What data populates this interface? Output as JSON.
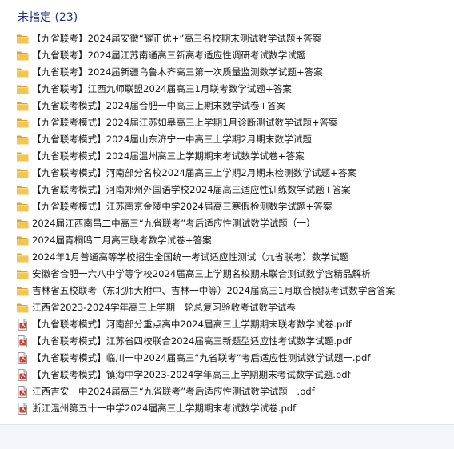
{
  "group": {
    "title": "未指定 (23)"
  },
  "files": [
    {
      "name": "【九省联考】2024届安徽“耀正优+”高三名校期末测试数学试题+答案",
      "icon": "folder-icon"
    },
    {
      "name": "【九省联考】2024届江苏南通高三新高考适应性调研考试数学试题",
      "icon": "folder-icon"
    },
    {
      "name": "【九省联考】2024届新疆乌鲁木齐高三第一次质量监测数学试题+答案",
      "icon": "folder-icon"
    },
    {
      "name": "【九省联考】江西九师联盟2024届高三1月联考数学试题+答案",
      "icon": "folder-icon"
    },
    {
      "name": "【九省联考模式】2024届合肥一中高三上期末数学试卷+答案",
      "icon": "folder-icon"
    },
    {
      "name": "【九省联考模式】2024届江苏如皋高三上学期1月诊断测试数学试题+答案",
      "icon": "folder-icon"
    },
    {
      "name": "【九省联考模式】2024届山东济宁一中高三上学期2月期末数学试题",
      "icon": "folder-icon"
    },
    {
      "name": "【九省联考模式】2024届温州高三上学期期末考试数学试卷+答案",
      "icon": "folder-icon"
    },
    {
      "name": "【九省联考模式】河南部分名校2024届高三上学期2月期末检测数学试题+答案",
      "icon": "folder-icon"
    },
    {
      "name": "【九省联考模式】河南郑州外国语学校2024届高三适应性训练数学试题+答案",
      "icon": "folder-icon"
    },
    {
      "name": "【九省联考模式】江苏南京金陵中学2024届高三寒假检测数学试题+答案",
      "icon": "folder-icon"
    },
    {
      "name": "2024届江西南昌二中高三“九省联考”考后适应性测试数学试题（一）",
      "icon": "folder-icon"
    },
    {
      "name": "2024届青桐鸣二月高三联考数学试卷+答案",
      "icon": "folder-icon"
    },
    {
      "name": "2024年1月普通高等学校招生全国统一考试适应性测试（九省联考）数学试题",
      "icon": "folder-icon"
    },
    {
      "name": "安徽省合肥一六八中学等学校2024届高三上学期名校期末联合测试数学含精品解析",
      "icon": "folder-icon"
    },
    {
      "name": "吉林省五校联考（东北师大附中、吉林一中等）2024届高三1月联合模拟考试数学含答案",
      "icon": "folder-icon"
    },
    {
      "name": "江西省2023-2024学年高三上学期一轮总复习验收考试数学试卷",
      "icon": "folder-icon"
    },
    {
      "name": "【九省联考模式】河南部分重点高中2024届高三上学期期末联考数学试卷.pdf",
      "icon": "pdf-icon"
    },
    {
      "name": "【九省联考模式】江苏省四校联合2024届高三新题型适应性考试数学试题.pdf",
      "icon": "pdf-icon"
    },
    {
      "name": "【九省联考模式】临川一中2024届高三“九省联考”考后适应性测试数学试题一.pdf",
      "icon": "pdf-icon"
    },
    {
      "name": "【九省联考模式】镇海中学2023-2024学年高三上学期期末考试数学试题.pdf",
      "icon": "pdf-icon"
    },
    {
      "name": "江西吉安一中2024届高三“九省联考”考后适应性测试数学试题一.pdf",
      "icon": "pdf-icon"
    },
    {
      "name": "浙江温州第五十一中学2024届高三上学期期末考试数学试卷.pdf",
      "icon": "pdf-icon"
    }
  ],
  "colors": {
    "header_text": "#1e3287",
    "folder": "#e8b73c",
    "pdf": "#d9342b",
    "footer_bg": "#f2f5fa"
  }
}
